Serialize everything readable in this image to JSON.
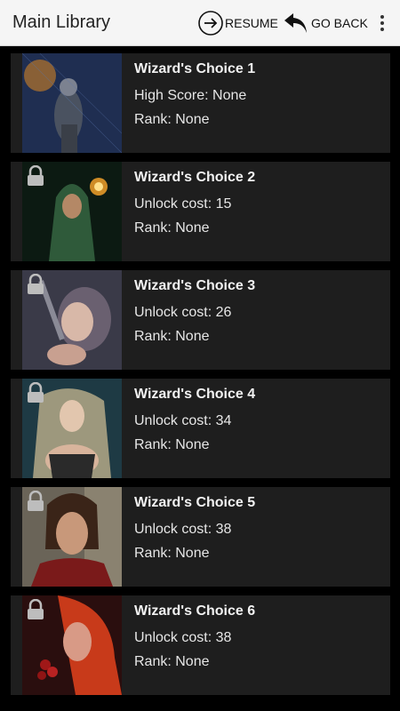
{
  "appbar": {
    "title": "Main Library",
    "resume_label": "RESUME",
    "goback_label": "GO BACK",
    "more_icon": "more-vertical-icon",
    "resume_icon": "arrow-circle-right-icon",
    "goback_icon": "undo-arrow-icon"
  },
  "colors": {
    "appbar_bg": "#f5f5f5",
    "screen_bg": "#000000",
    "card_bg": "#1e1e1e",
    "text": "#f2f2f2"
  },
  "items": [
    {
      "name": "Wizard's Choice 1",
      "line1": "High Score: None",
      "line2": "Rank: None",
      "locked": false
    },
    {
      "name": "Wizard's Choice 2",
      "line1": "Unlock cost: 15",
      "line2": "Rank: None",
      "locked": true
    },
    {
      "name": "Wizard's Choice 3",
      "line1": "Unlock cost: 26",
      "line2": "Rank: None",
      "locked": true
    },
    {
      "name": "Wizard's Choice 4",
      "line1": "Unlock cost: 34",
      "line2": "Rank: None",
      "locked": true
    },
    {
      "name": "Wizard's Choice 5",
      "line1": "Unlock cost: 38",
      "line2": "Rank: None",
      "locked": true
    },
    {
      "name": "Wizard's Choice 6",
      "line1": "Unlock cost: 38",
      "line2": "Rank: None",
      "locked": true
    }
  ]
}
